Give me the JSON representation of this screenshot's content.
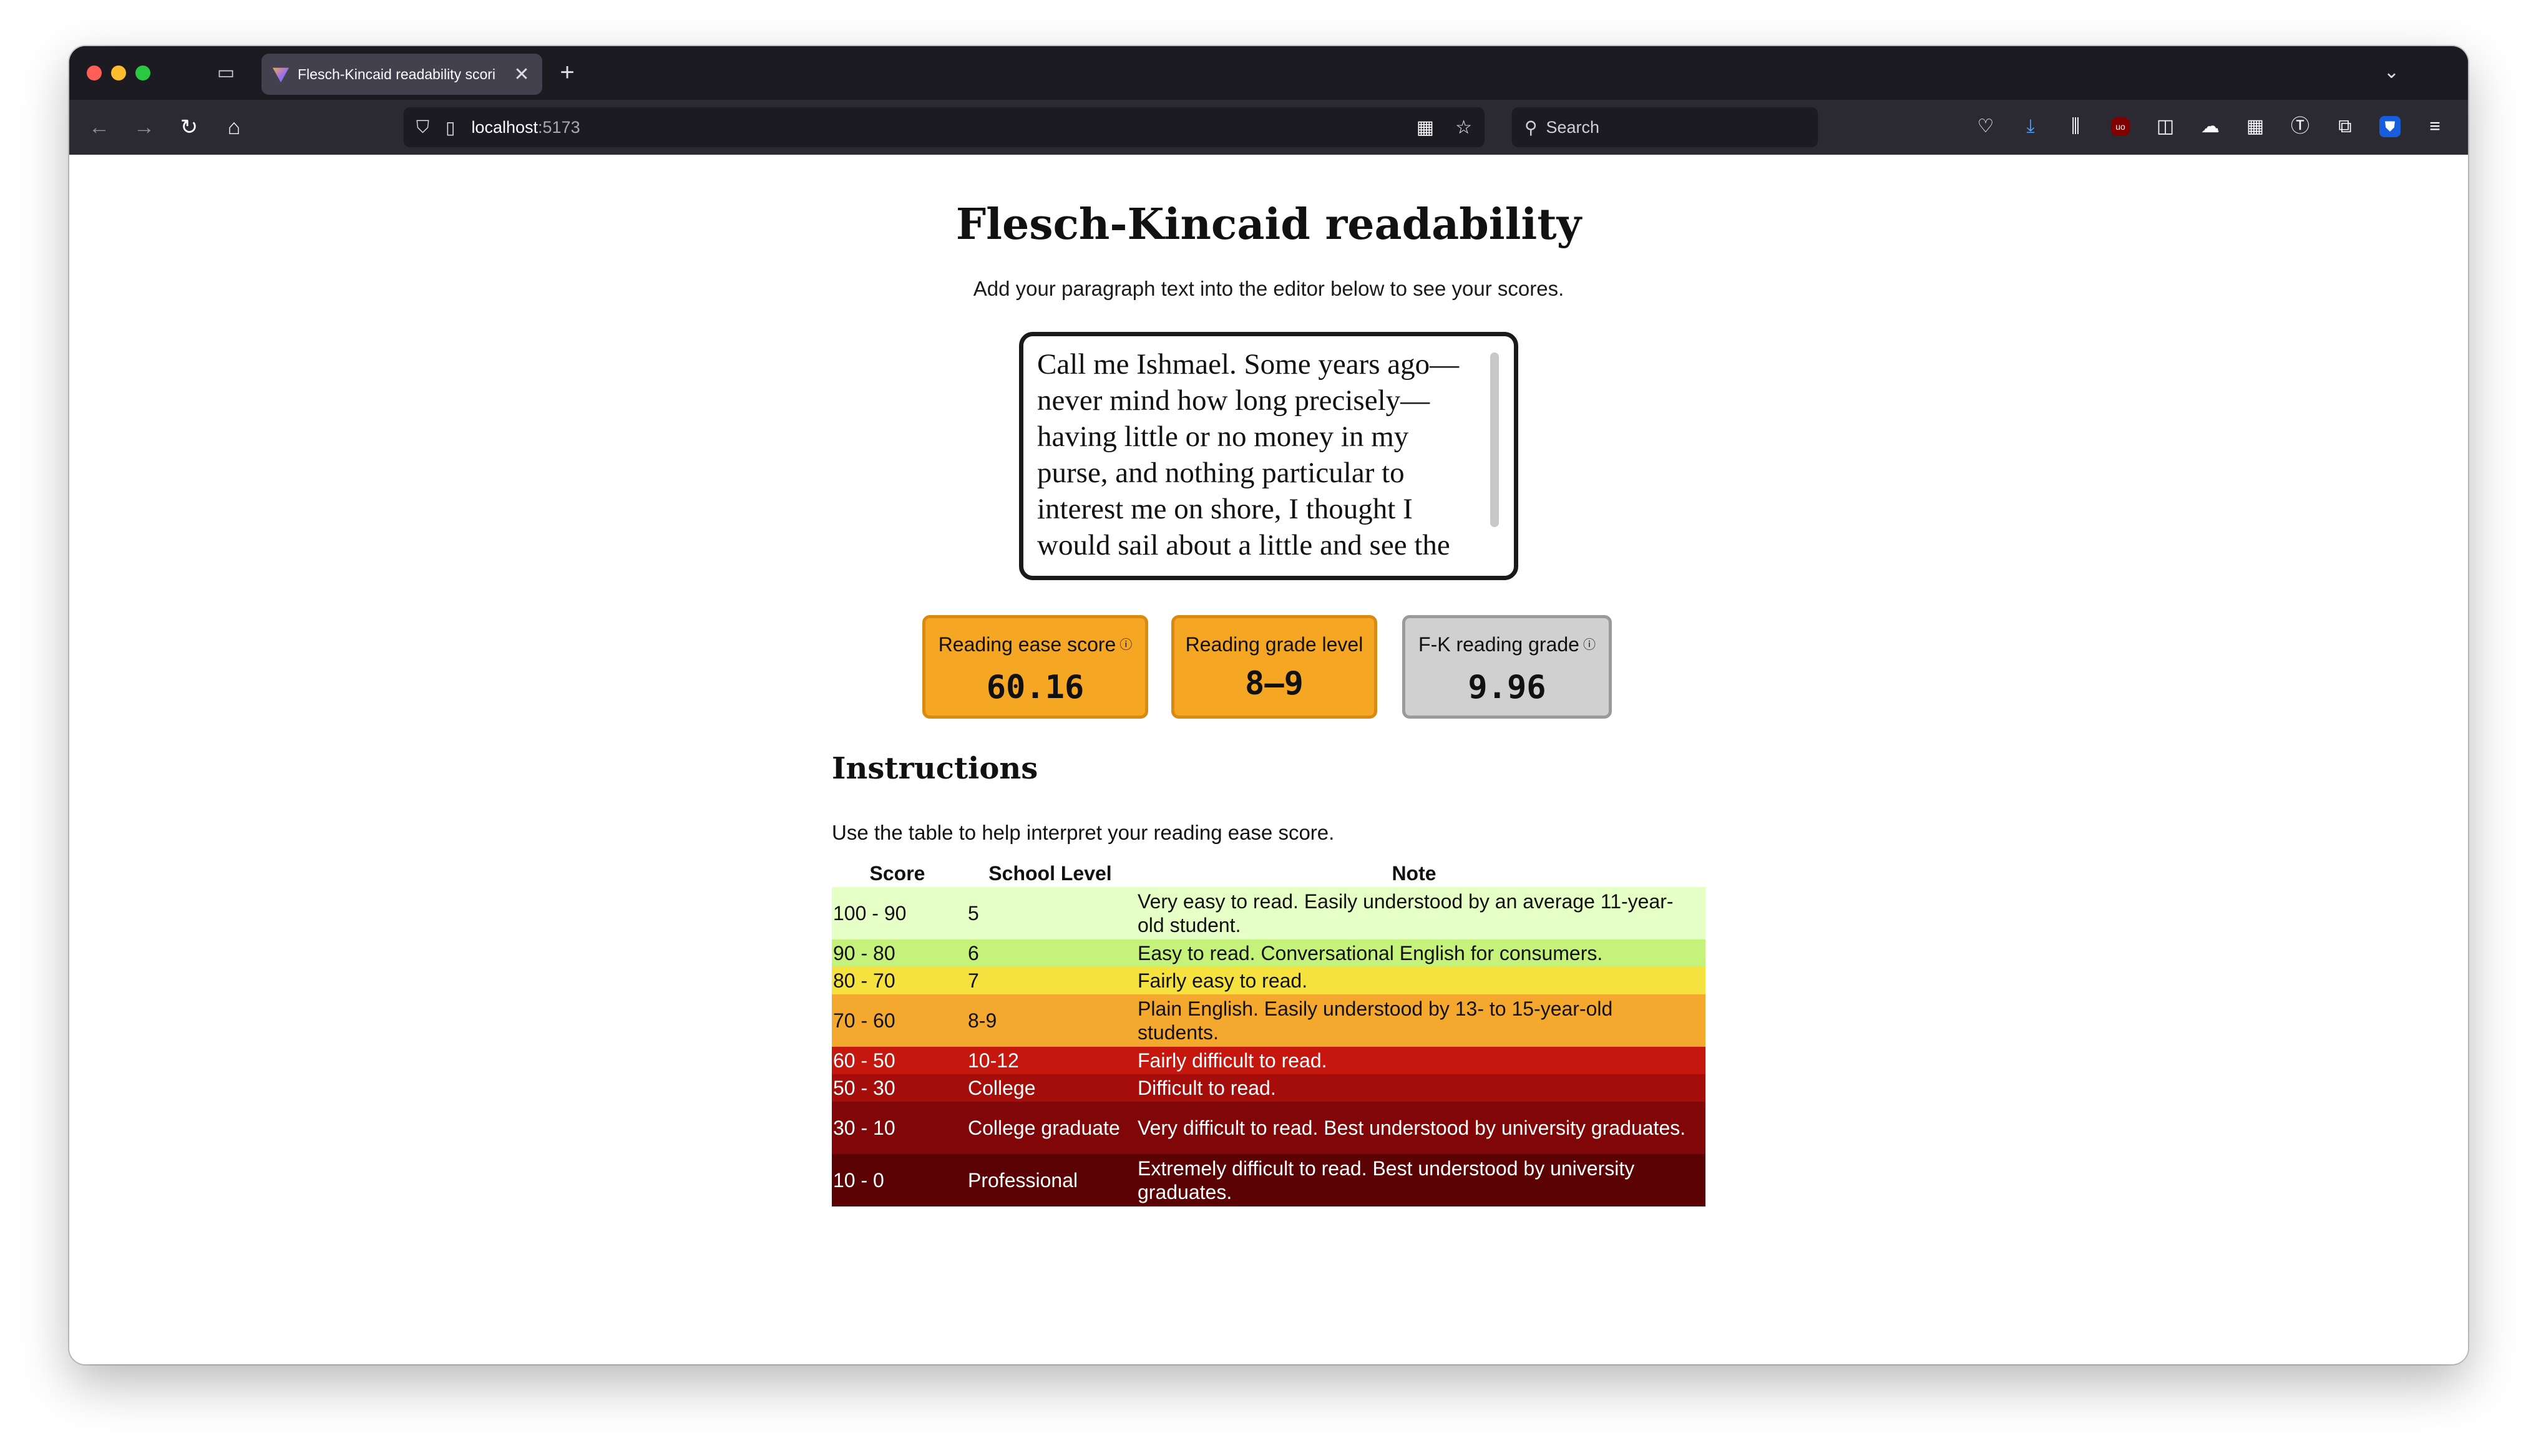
{
  "browser": {
    "tab_title": "Flesch-Kincaid readability scori",
    "url_host": "localhost",
    "url_port": ":5173",
    "search_placeholder": "Search",
    "tab_close": "✕",
    "new_tab": "+",
    "tab_list": "⌄"
  },
  "page": {
    "title": "Flesch-Kincaid readability",
    "subtitle": "Add your paragraph text into the editor below to see your scores.",
    "editor_text": "Call me Ishmael. Some years ago—never mind how long precisely—having little or no money in my purse, and nothing particular to interest me on shore, I thought I would sail about a little and see the"
  },
  "scores": {
    "ease_label": "Reading ease score",
    "ease_value": "60.16",
    "grade_label": "Reading grade level",
    "grade_value": "8–9",
    "fk_label": "F-K reading grade",
    "fk_value": "9.96",
    "info_glyph": "ⓘ"
  },
  "instructions": {
    "title": "Instructions",
    "text": "Use the table to help interpret your reading ease score.",
    "headers": [
      "Score",
      "School Level",
      "Note"
    ],
    "rows": [
      {
        "score": "100 - 90",
        "level": "5",
        "note": "Very easy to read. Easily understood by an average 11-year-old student.",
        "bg": "#e6ffc7",
        "fg": "#111111"
      },
      {
        "score": "90 - 80",
        "level": "6",
        "note": "Easy to read. Conversational English for consumers.",
        "bg": "#c5f27a",
        "fg": "#111111"
      },
      {
        "score": "80 - 70",
        "level": "7",
        "note": "Fairly easy to read.",
        "bg": "#f5e23f",
        "fg": "#111111"
      },
      {
        "score": "70 - 60",
        "level": "8-9",
        "note": "Plain English. Easily understood by 13- to 15-year-old students.",
        "bg": "#f5a82e",
        "fg": "#111111"
      },
      {
        "score": "60 - 50",
        "level": "10-12",
        "note": "Fairly difficult to read.",
        "bg": "#c5170d",
        "fg": "#ffffff"
      },
      {
        "score": "50 - 30",
        "level": "College",
        "note": "Difficult to read.",
        "bg": "#a50d0b",
        "fg": "#ffffff"
      },
      {
        "score": "30 - 10",
        "level": "College graduate",
        "note": "Very difficult to read. Best understood by university graduates.",
        "bg": "#800607",
        "fg": "#ffffff"
      },
      {
        "score": "10 - 0",
        "level": "Professional",
        "note": "Extremely difficult to read. Best understood by university graduates.",
        "bg": "#5a0204",
        "fg": "#ffffff"
      }
    ]
  },
  "icons": [
    "archive-icon",
    "back-icon",
    "forward-icon",
    "reload-icon",
    "home-icon",
    "shield-icon",
    "page-icon",
    "grid-icon",
    "star-icon",
    "search-icon",
    "pocket-icon",
    "download-icon",
    "library-icon",
    "ublock-icon",
    "sidebar-icon",
    "extension-icon",
    "apps-icon",
    "t-icon",
    "puzzle-icon",
    "bitwarden-icon",
    "menu-icon"
  ]
}
